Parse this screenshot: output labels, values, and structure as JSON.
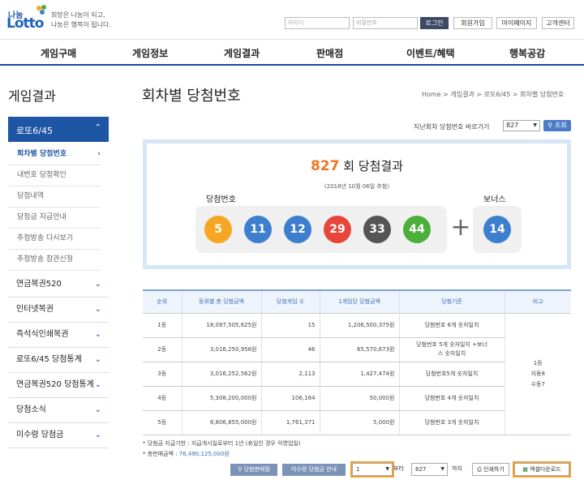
{
  "header": {
    "logo_top": "나눔",
    "logo_main": "Lotto",
    "slogan_line1": "희망은 나눔이 되고,",
    "slogan_line2": "나눔은 행복이 됩니다.",
    "id_placeholder": "아이디",
    "pw_placeholder": "비밀번호",
    "login": "로그인",
    "signup": "회원가입",
    "mypage": "마이페이지",
    "support": "고객센터"
  },
  "nav": [
    "게임구매",
    "게임정보",
    "게임결과",
    "판매점",
    "이벤트/혜택",
    "행복공감"
  ],
  "sidebar": {
    "title": "게임결과",
    "active": "로또6/45",
    "subitems": [
      "회차별 당첨번호",
      "내번호 당첨확인",
      "당첨내역",
      "당첨금 지급안내",
      "추첨방송 다시보기",
      "추첨방송 참관신청"
    ],
    "items": [
      "연금복권520",
      "인터넷복권",
      "즉석식인쇄복권",
      "로또6/45 당첨통계",
      "연금복권520 당첨통계",
      "당첨소식",
      "미수령 당첨금"
    ]
  },
  "main": {
    "page_title": "회차별 당첨번호",
    "breadcrumb": "Home > 게임결과 > 로또6/45 > 회차별 당첨번호",
    "jump_label": "지난회차 당첨번호 바로가기",
    "jump_value": "827",
    "jump_button": "조회",
    "round_number": "827",
    "round_suffix": "회 당첨결과",
    "round_date": "(2018년 10월 06일 추첨)",
    "win_label": "당첨번호",
    "bonus_label": "보너스",
    "plus": "+"
  },
  "balls": [
    {
      "n": "5",
      "color": "#f5a623"
    },
    {
      "n": "11",
      "color": "#3d7ecf"
    },
    {
      "n": "12",
      "color": "#3d7ecf"
    },
    {
      "n": "29",
      "color": "#e8463a"
    },
    {
      "n": "33",
      "color": "#555555"
    },
    {
      "n": "44",
      "color": "#4caf3a"
    }
  ],
  "bonus_ball": {
    "n": "14",
    "color": "#3d7ecf"
  },
  "table": {
    "headers": [
      "순위",
      "등위별 총 당첨금액",
      "당첨게임 수",
      "1게임당 당첨금액",
      "당첨기준",
      "비고"
    ],
    "rows": [
      [
        "1등",
        "18,097,505,625원",
        "15",
        "1,206,500,375원",
        "당첨번호 6개 숫자일치"
      ],
      [
        "2등",
        "3,016,250,958원",
        "46",
        "65,570,673원",
        "당첨번호 5개 숫자일치 +보너스 숫자일치"
      ],
      [
        "3등",
        "3,016,252,562원",
        "2,113",
        "1,427,474원",
        "당첨번호5개 숫자일치"
      ],
      [
        "4등",
        "5,308,200,000원",
        "106,164",
        "50,000원",
        "당첨번호 4개 숫자일치"
      ],
      [
        "5등",
        "8,806,855,000원",
        "1,761,371",
        "5,000원",
        "당첨번호 3개 숫자일치"
      ]
    ],
    "note_lines": [
      "1등",
      "자동8",
      "수동7"
    ]
  },
  "notes": {
    "line1": "* 당첨금 지급기한 : 지급개시일로부터 1년 (휴일인 경우 익영업일)",
    "line2_label": "* 총판매금액 : ",
    "line2_value": "76,490,125,000원"
  },
  "bottom": {
    "btn_stores": "당첨판매점",
    "btn_unclaimed": "미수령 당첨금 안내",
    "from_value": "1",
    "from_label": "부터",
    "to_value": "827",
    "to_label": "까지",
    "print": "인쇄하기",
    "excel": "엑셀다운로드"
  }
}
